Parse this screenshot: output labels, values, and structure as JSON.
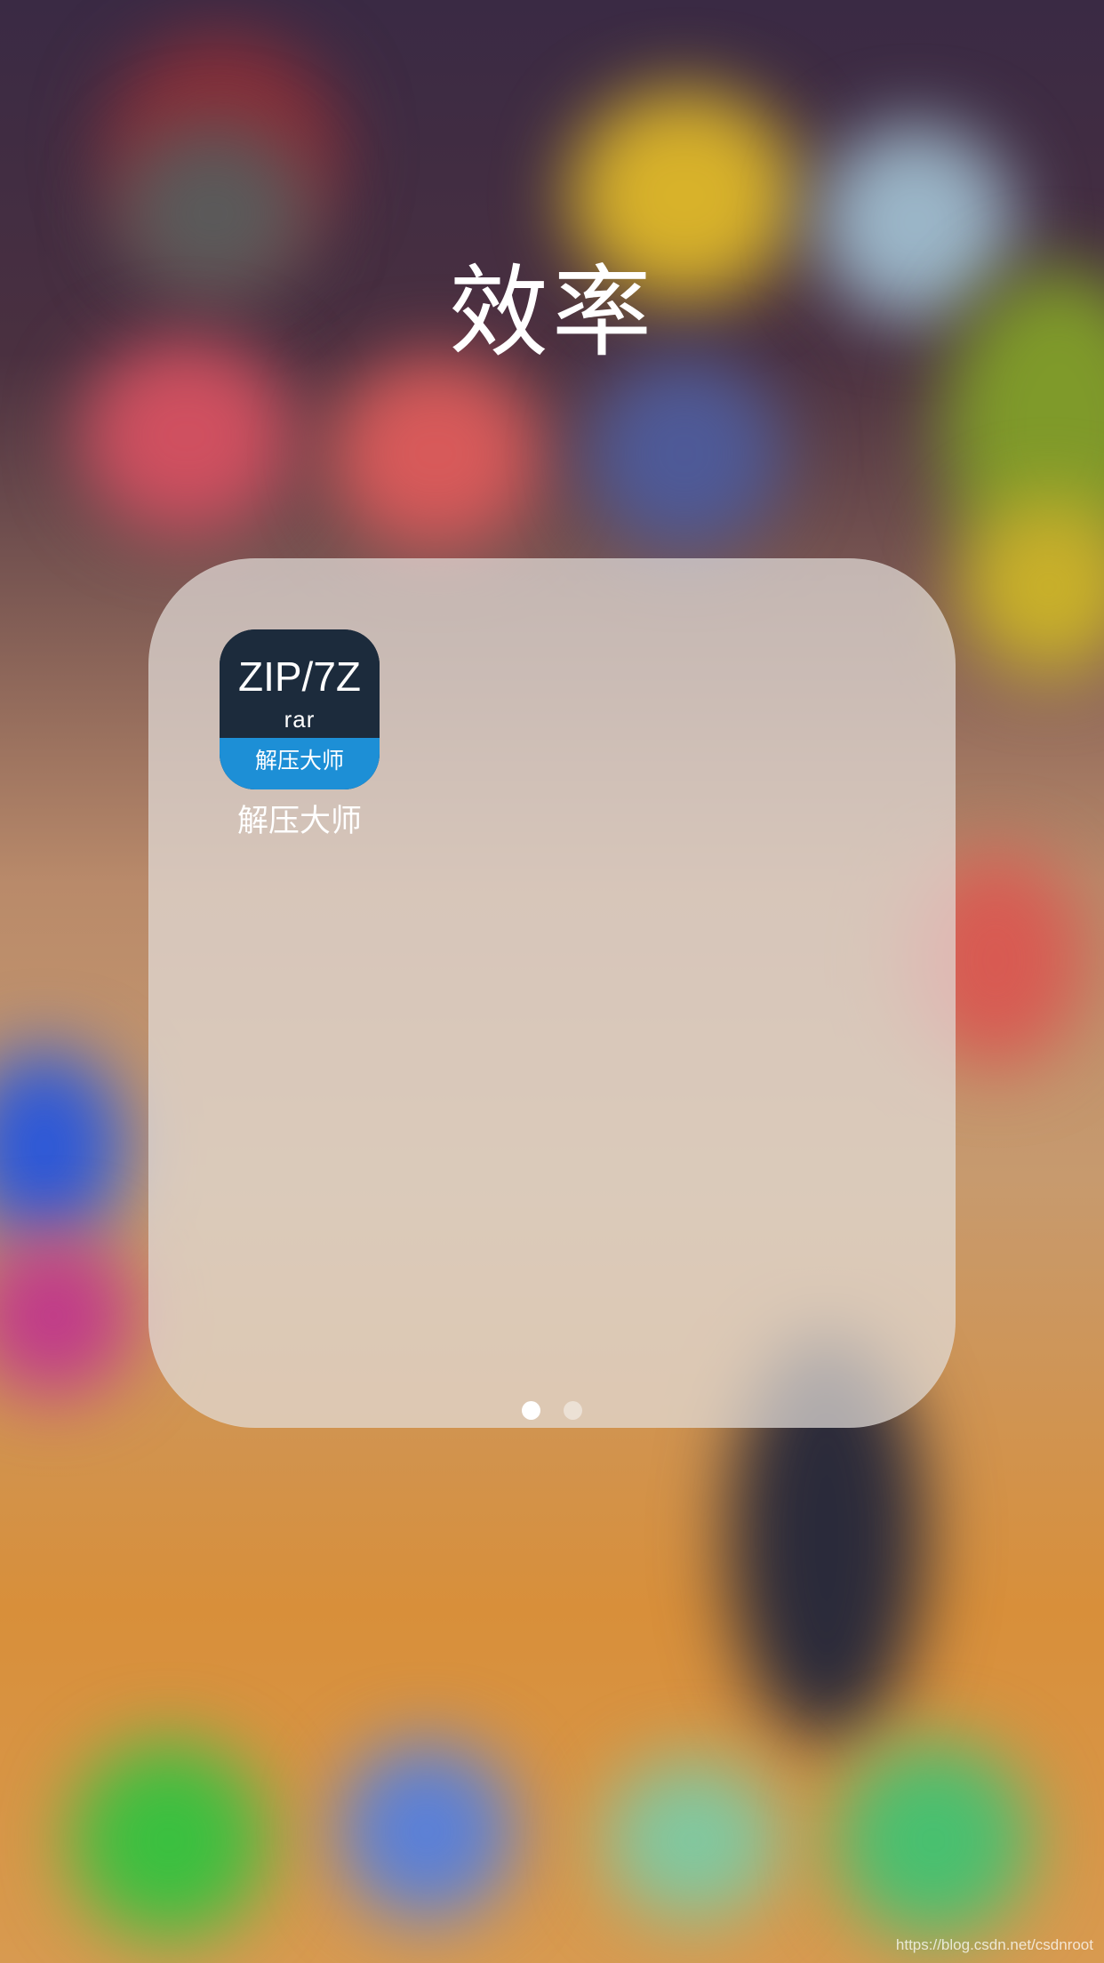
{
  "folder": {
    "title": "效率",
    "apps": [
      {
        "name": "解压大师",
        "icon": {
          "line1": "ZIP/7Z",
          "line2": "rar",
          "banner": "解压大师",
          "top_color": "#1c2b3c",
          "banner_color": "#1d8fd6"
        }
      }
    ],
    "pages": {
      "current": 1,
      "total": 2
    }
  },
  "watermark": "https://blog.csdn.net/csdnroot"
}
